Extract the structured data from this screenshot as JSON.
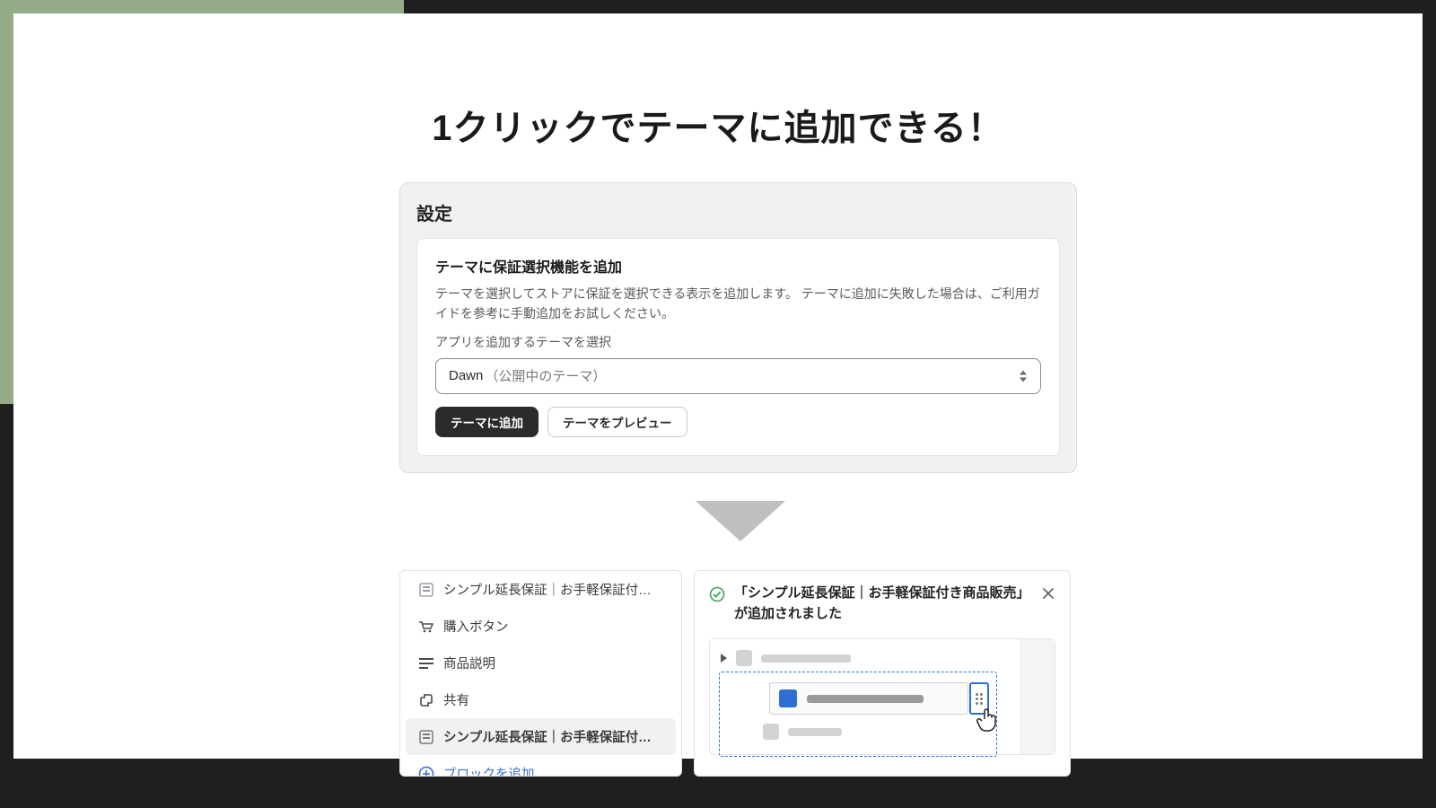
{
  "headline": "1クリックでテーマに追加できる！",
  "settings": {
    "title": "設定",
    "subtitle": "テーマに保証選択機能を追加",
    "description": "テーマを選択してストアに保証を選択できる表示を追加します。 テーマに追加に失敗した場合は、ご利用ガイドを参考に手動追加をお試しください。",
    "select_label": "アプリを追加するテーマを選択",
    "select_value": "Dawn",
    "select_value_suffix": "（公開中のテーマ）",
    "add_button": "テーマに追加",
    "preview_button": "テーマをプレビュー"
  },
  "sidebar": {
    "items": [
      {
        "label": "シンプル延長保証｜お手軽保証付…",
        "icon": "block"
      },
      {
        "label": "購入ボタン",
        "icon": "cart"
      },
      {
        "label": "商品説明",
        "icon": "lines"
      },
      {
        "label": "共有",
        "icon": "share"
      },
      {
        "label": "シンプル延長保証｜お手軽保証付…",
        "icon": "block",
        "selected": true
      }
    ],
    "add_label": "ブロックを追加"
  },
  "toast": {
    "message": "「シンプル延長保証｜お手軽保証付き商品販売」が追加されました"
  }
}
